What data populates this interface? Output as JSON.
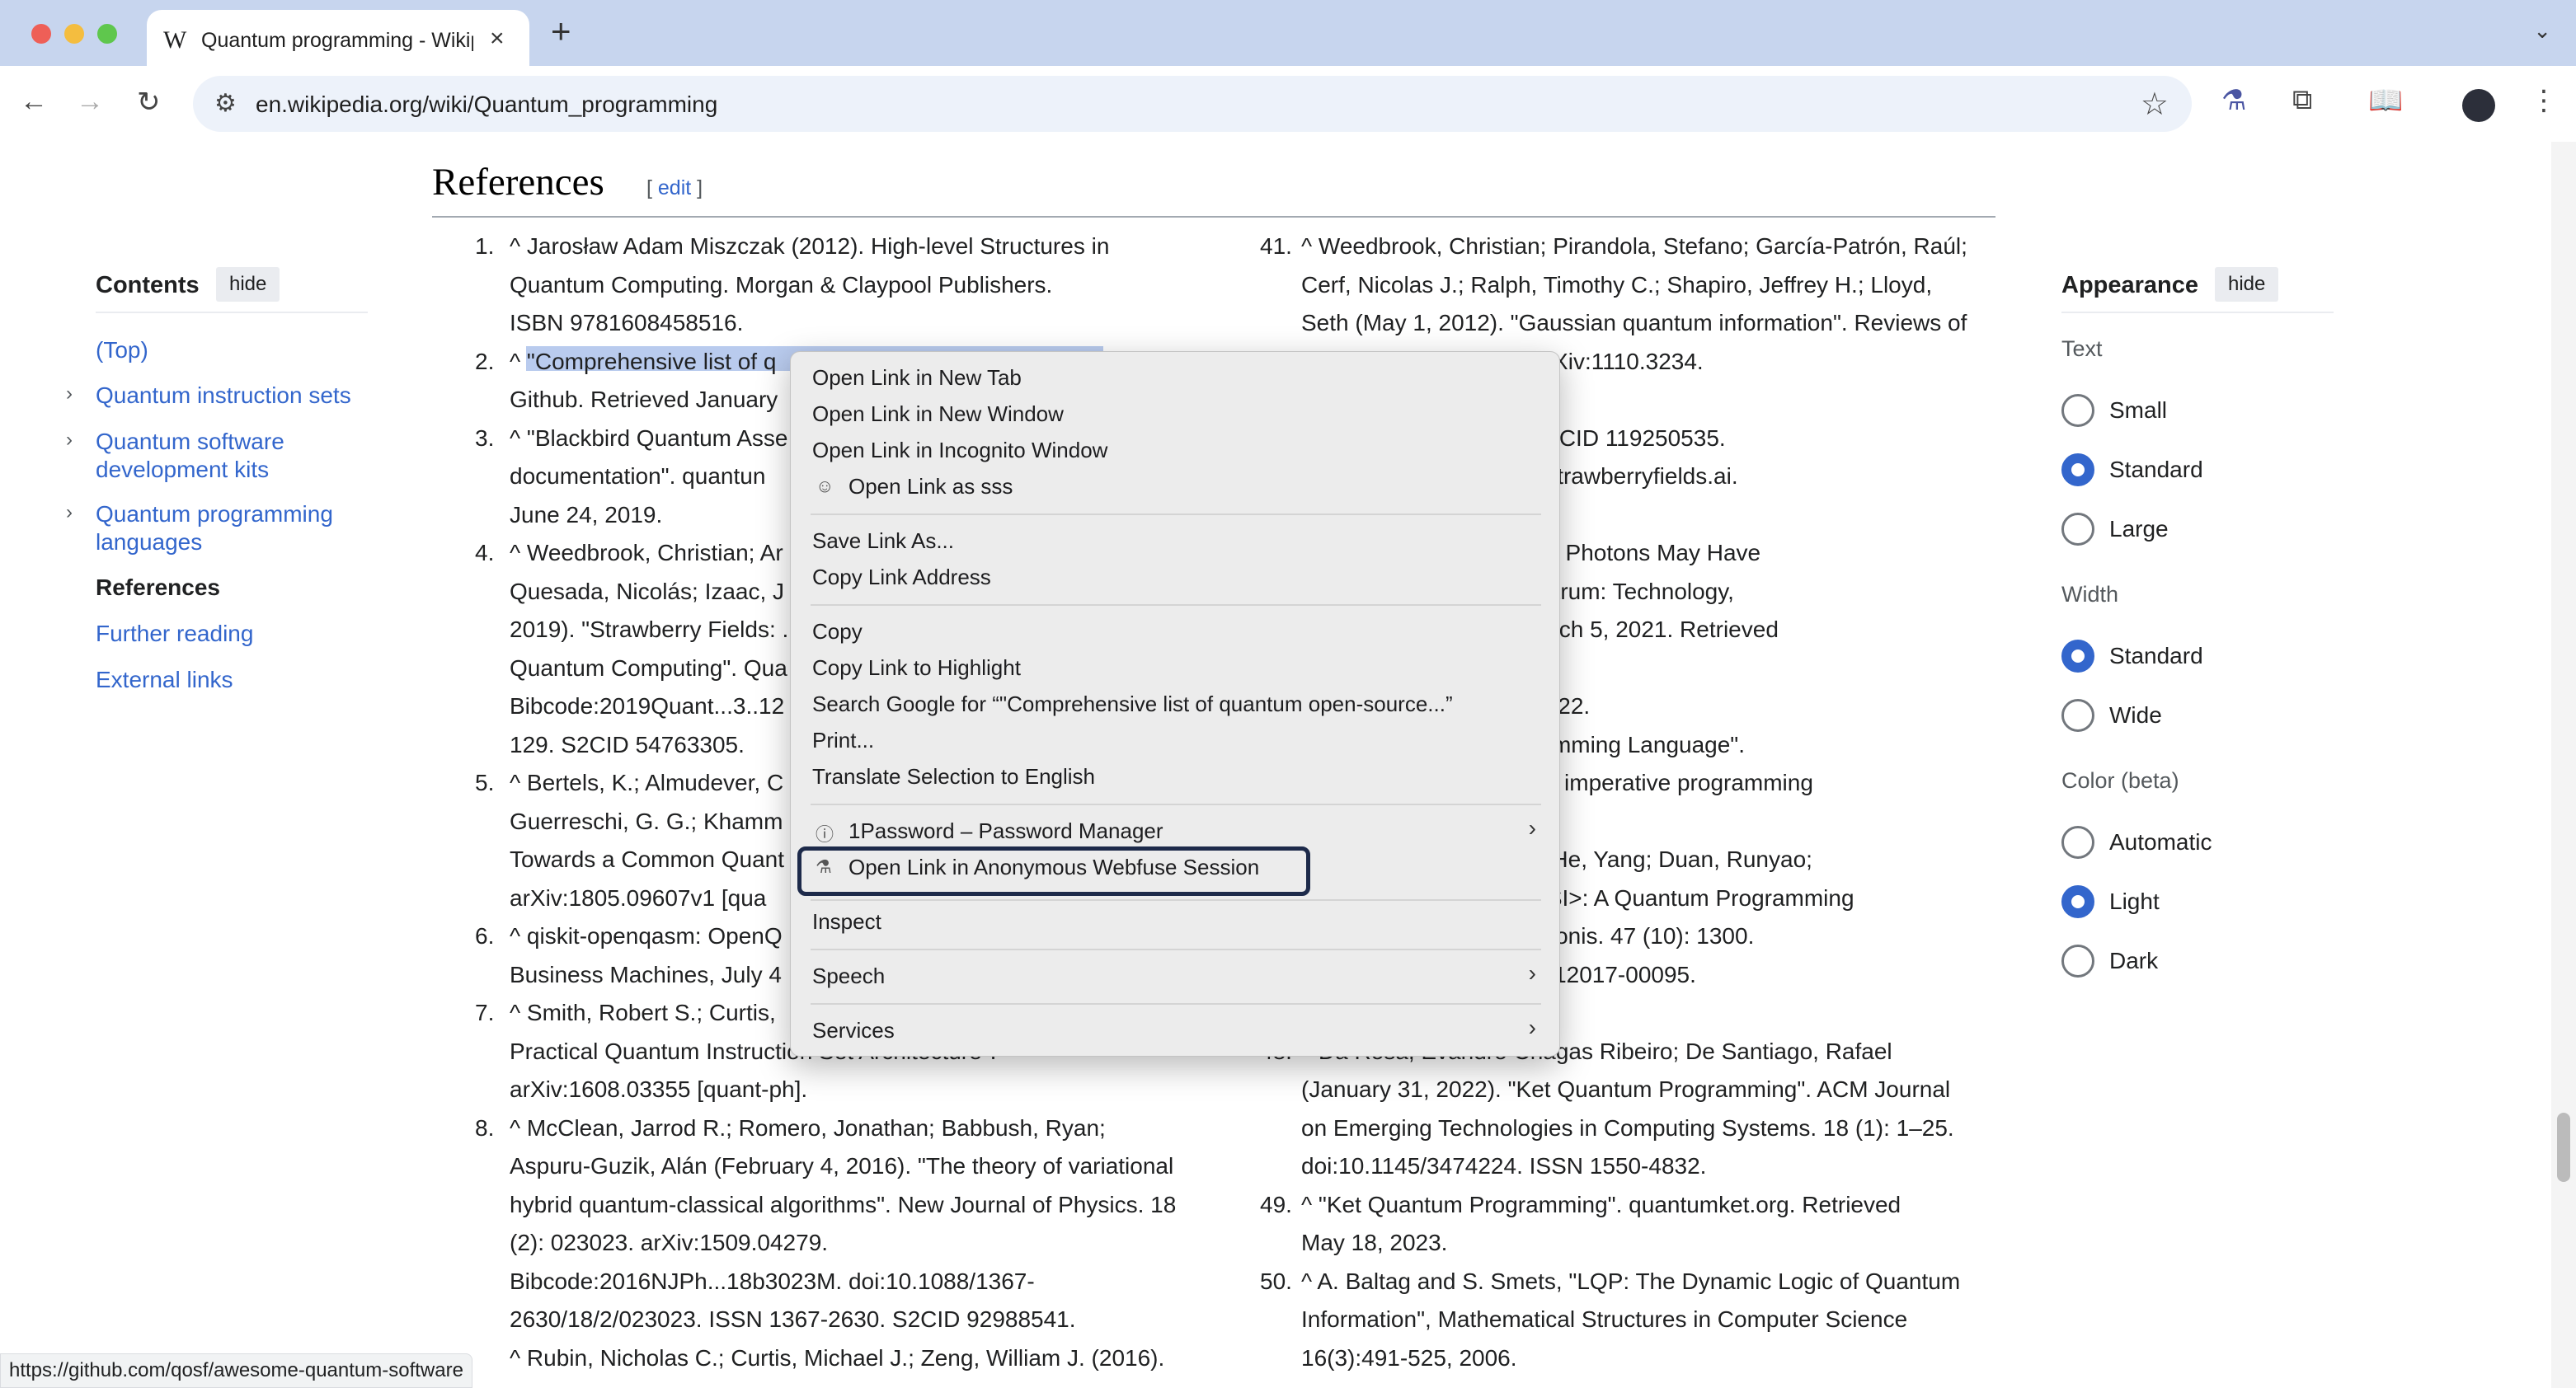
{
  "browser": {
    "tab": {
      "favicon": "W",
      "title": "Quantum programming - Wikipedia",
      "close": "×"
    },
    "new_tab": "+",
    "tab_search": "⌄",
    "url": "en.wikipedia.org/wiki/Quantum_programming",
    "icons": {
      "back": "←",
      "forward": "→",
      "reload": "↻",
      "site_info": "⚙",
      "star": "☆",
      "webfuse": "⚗",
      "extensions": "⧉",
      "reading_list": "📖",
      "menu": "⋮"
    }
  },
  "sidebar": {
    "title": "Contents",
    "hide_label": "hide",
    "items": [
      {
        "label": "(Top)"
      },
      {
        "label": "Quantum instruction sets",
        "expandable": true
      },
      {
        "label": "Quantum software",
        "label2": "development kits",
        "expandable": true
      },
      {
        "label": "Quantum programming",
        "label2": "languages",
        "expandable": true
      },
      {
        "label": "References"
      },
      {
        "label": "Further reading"
      },
      {
        "label": "External links"
      }
    ]
  },
  "heading": {
    "title": "References",
    "edit_open": "[ ",
    "edit_label": "edit",
    "edit_close": " ]"
  },
  "refs_left": [
    {
      "num": "1.",
      "text": "^ Jarosław Adam Miszczak (2012). High-level Structures in"
    },
    {
      "num": "",
      "text": "Quantum Computing. Morgan & Claypool Publishers."
    },
    {
      "num": "",
      "text": "ISBN 9781608458516."
    },
    {
      "num": "2.",
      "text": "^ \"Comprehensive list of q"
    },
    {
      "num": "",
      "text": "Github. Retrieved January"
    },
    {
      "num": "3.",
      "text": "^ \"Blackbird Quantum Asse"
    },
    {
      "num": "",
      "text": "documentation\". quantun"
    },
    {
      "num": "",
      "text": "June 24, 2019."
    },
    {
      "num": "4.",
      "text": "^ Weedbrook, Christian; Ar"
    },
    {
      "num": "",
      "text": "Quesada, Nicolás; Izaac, J"
    },
    {
      "num": "",
      "text": "2019). \"Strawberry Fields: ."
    },
    {
      "num": "",
      "text": "Quantum Computing\". Qua"
    },
    {
      "num": "",
      "text": "Bibcode:2019Quant...3..12"
    },
    {
      "num": "",
      "text": "129. S2CID 54763305."
    },
    {
      "num": "5.",
      "text": "^ Bertels, K.; Almudever, C"
    },
    {
      "num": "",
      "text": "Guerreschi, G. G.; Khamm"
    },
    {
      "num": "",
      "text": "Towards a Common Quant"
    },
    {
      "num": "",
      "text": "arXiv:1805.09607v1 [qua"
    },
    {
      "num": "6.",
      "text": "^ qiskit-openqasm: OpenQ"
    },
    {
      "num": "",
      "text": "Business Machines, July 4"
    },
    {
      "num": "7.",
      "text": "^ Smith, Robert S.; Curtis,"
    },
    {
      "num": "",
      "text": "Practical Quantum Instruction Set Architecture\"."
    },
    {
      "num": "",
      "text": "arXiv:1608.03355 [quant-ph]."
    },
    {
      "num": "8.",
      "text": "^ McClean, Jarrod R.; Romero, Jonathan; Babbush, Ryan;"
    },
    {
      "num": "",
      "text": "Aspuru-Guzik, Alán (February 4, 2016). \"The theory of variational"
    },
    {
      "num": "",
      "text": "hybrid quantum-classical algorithms\". New Journal of Physics. 18"
    },
    {
      "num": "",
      "text": "(2): 023023. arXiv:1509.04279."
    },
    {
      "num": "",
      "text": "Bibcode:2016NJPh...18b3023M. doi:10.1088/1367-"
    },
    {
      "num": "",
      "text": "2630/18/2/023023. ISSN 1367-2630. S2CID 92988541."
    },
    {
      "num": "",
      "text": "^ Rubin, Nicholas C.; Curtis, Michael J.; Zeng, William J. (2016)."
    }
  ],
  "refs_right": [
    {
      "num": "41.",
      "text": "^ Weedbrook, Christian; Pirandola, Stefano; García-Patrón, Raúl;"
    },
    {
      "num": "",
      "text": "Cerf, Nicolas J.; Ralph, Timothy C.; Shapiro, Jeffrey H.; Lloyd,"
    },
    {
      "num": "",
      "text": "Seth (May 1, 2012). \"Gaussian quantum information\". Reviews of"
    },
    {
      "num": "",
      "text": "                    621–669. arXiv:1110.3234."
    },
    {
      "num": "",
      "text": "                    .621W."
    },
    {
      "num": "",
      "text": "                    s.84.621. S2CID 119250535."
    },
    {
      "num": "",
      "text": "                    rry Fields\". strawberryfields.ai."
    },
    {
      "num": "",
      "text": "                    1."
    },
    {
      "num": "",
      "text": "                    ds of Qubits, Photons May Have"
    },
    {
      "num": "",
      "text": "                    . IEEE Spectrum: Technology,"
    },
    {
      "num": "",
      "text": "                    e News. March 5, 2021. Retrieved"
    },
    {
      "num": "",
      "text": ""
    },
    {
      "num": "",
      "text": "                    nuary 22, 2022."
    },
    {
      "num": "",
      "text": "                    QCL Programming Language\"."
    },
    {
      "num": "",
      "text": "                    – a quantum imperative programming"
    },
    {
      "num": "",
      "text": ""
    },
    {
      "num": "",
      "text": "                    li; Guan, Ji; He, Yang; Duan, Runyao;"
    },
    {
      "num": "",
      "text": "                    , 2017). \"QISI>: A Quantum Programming"
    },
    {
      "num": "",
      "text": "                    ica Informationis. 47 (10): 1300."
    },
    {
      "num": "",
      "text": "                    :10.1360/N112017-00095."
    },
    {
      "num": "",
      "text": ""
    },
    {
      "num": "48.",
      "text": "^ Da Rosa, Evandro Chagas Ribeiro; De Santiago, Rafael"
    },
    {
      "num": "",
      "text": "(January 31, 2022). \"Ket Quantum Programming\". ACM Journal"
    },
    {
      "num": "",
      "text": "on Emerging Technologies in Computing Systems. 18 (1): 1–25."
    },
    {
      "num": "",
      "text": "doi:10.1145/3474224. ISSN 1550-4832."
    },
    {
      "num": "49.",
      "text": "^ \"Ket Quantum Programming\". quantumket.org. Retrieved"
    },
    {
      "num": "",
      "text": "May 18, 2023."
    },
    {
      "num": "50.",
      "text": "^ A. Baltag and S. Smets, \"LQP: The Dynamic Logic of Quantum"
    },
    {
      "num": "",
      "text": "Information\", Mathematical Structures in Computer Science"
    },
    {
      "num": "",
      "text": "16(3):491-525, 2006."
    }
  ],
  "appearance": {
    "title": "Appearance",
    "hide_label": "hide",
    "text_label": "Text",
    "text_options": [
      "Small",
      "Standard",
      "Large"
    ],
    "text_selected": "Standard",
    "width_label": "Width",
    "width_options": [
      "Standard",
      "Wide"
    ],
    "width_selected": "Standard",
    "color_label": "Color (beta)",
    "color_options": [
      "Automatic",
      "Light",
      "Dark"
    ],
    "color_selected": "Light"
  },
  "status_url": "https://github.com/qosf/awesome-quantum-software",
  "context_menu": {
    "open_new_tab": "Open Link in New Tab",
    "open_new_window": "Open Link in New Window",
    "open_incognito": "Open Link in Incognito Window",
    "open_as_profile": "Open Link as sss",
    "save_link_as": "Save Link As...",
    "copy_link_address": "Copy Link Address",
    "copy": "Copy",
    "copy_link_highlight": "Copy Link to Highlight",
    "search_google": "Search Google for “\"Comprehensive list of quantum open-source...”",
    "print": "Print...",
    "translate": "Translate Selection to English",
    "password_manager": "1Password – Password Manager",
    "webfuse": "Open Link in Anonymous Webfuse Session",
    "inspect": "Inspect",
    "speech": "Speech",
    "services": "Services",
    "submenu_arrow": "›"
  }
}
